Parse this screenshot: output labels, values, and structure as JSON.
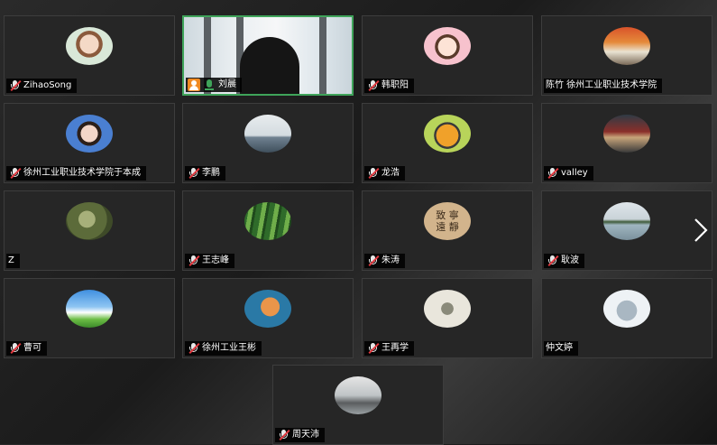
{
  "participants": [
    {
      "name": "ZihaoSong",
      "muted": true,
      "avatar": "anime-boy"
    },
    {
      "name": "刘晨",
      "muted": false,
      "host": true,
      "video_on": true,
      "avatar": "camera-feed"
    },
    {
      "name": "韩职阳",
      "muted": true,
      "avatar": "cartoon-girl"
    },
    {
      "name": "陈竹  徐州工业职业技术学院",
      "muted": false,
      "avatar": "autumn-house"
    },
    {
      "name": "徐州工业职业技术学院于本成",
      "muted": true,
      "avatar": "girl-photo"
    },
    {
      "name": "李鹏",
      "muted": true,
      "avatar": "palm-beach"
    },
    {
      "name": "龙浩",
      "muted": true,
      "avatar": "cartoon-creature"
    },
    {
      "name": "valley",
      "muted": true,
      "avatar": "building-photo"
    },
    {
      "name": "Z",
      "muted": false,
      "avatar": "trees"
    },
    {
      "name": "王志峰",
      "muted": true,
      "avatar": "bamboo"
    },
    {
      "name": "朱涛",
      "muted": true,
      "avatar": "calligraphy"
    },
    {
      "name": "耿波",
      "muted": true,
      "avatar": "lake"
    },
    {
      "name": "曹可",
      "muted": true,
      "avatar": "blue-sky"
    },
    {
      "name": "徐州工业王彬",
      "muted": true,
      "avatar": "cat-illustration"
    },
    {
      "name": "王再学",
      "muted": true,
      "avatar": "sketch"
    },
    {
      "name": "仲文婷",
      "muted": false,
      "avatar": "totoro"
    },
    {
      "name": "周天沛",
      "muted": true,
      "avatar": "classroom"
    }
  ],
  "calligraphy_text": "致 寧 遠 靜",
  "colors": {
    "active_border": "#3fa45a",
    "muted_icon": "#e2383f",
    "host_badge": "#f08a22"
  },
  "navigation": {
    "next_icon": "chevron-right-icon"
  }
}
